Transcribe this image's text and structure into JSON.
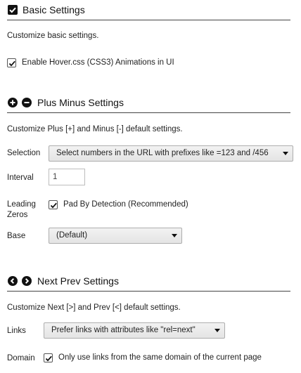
{
  "basic": {
    "title": "Basic Settings",
    "description": "Customize basic settings.",
    "hover_label": "Enable Hover.css (CSS3) Animations in UI",
    "hover_checked": true
  },
  "plus_minus": {
    "title": "Plus Minus Settings",
    "description": "Customize Plus [+] and Minus [-] default settings.",
    "selection_label": "Selection",
    "selection_value": "Select numbers in the URL with prefixes like =123 and /456",
    "interval_label": "Interval",
    "interval_value": "1",
    "leading_label_1": "Leading",
    "leading_label_2": "Zeros",
    "pad_label": "Pad By Detection (Recommended)",
    "pad_checked": true,
    "base_label": "Base",
    "base_value": "(Default)"
  },
  "next_prev": {
    "title": "Next Prev Settings",
    "description": "Customize Next [>] and Prev [<] default settings.",
    "links_label": "Links",
    "links_value": "Prefer links with attributes like \"rel=next\"",
    "domain_label": "Domain",
    "domain_option": "Only use links from the same domain of the current page",
    "domain_checked": true
  },
  "icons": {
    "basic": "checkbox-checked-icon",
    "plus": "plus-circle-icon",
    "minus": "minus-circle-icon",
    "prev": "chevron-left-circle-icon",
    "next": "chevron-right-circle-icon"
  }
}
